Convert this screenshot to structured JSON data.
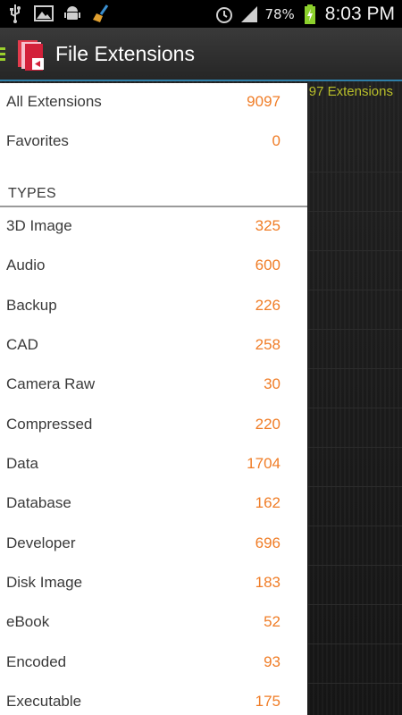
{
  "status_bar": {
    "battery_percent": "78%",
    "time": "8:03 PM",
    "icons": [
      "usb-icon",
      "image-icon",
      "android-debug-icon",
      "broom-icon",
      "alarm-icon",
      "signal-icon",
      "battery-charging-icon"
    ]
  },
  "action_bar": {
    "title": "File Extensions",
    "accent_color": "#9bd02c",
    "underline_color": "#2f7fa8"
  },
  "background": {
    "count_label": "97 Extensions",
    "count_color": "#b9bf2a"
  },
  "drawer": {
    "top_items": [
      {
        "label": "All Extensions",
        "count": "9097"
      },
      {
        "label": "Favorites",
        "count": "0"
      }
    ],
    "section_header": "TYPES",
    "types": [
      {
        "label": "3D Image",
        "count": "325"
      },
      {
        "label": "Audio",
        "count": "600"
      },
      {
        "label": "Backup",
        "count": "226"
      },
      {
        "label": "CAD",
        "count": "258"
      },
      {
        "label": "Camera Raw",
        "count": "30"
      },
      {
        "label": "Compressed",
        "count": "220"
      },
      {
        "label": "Data",
        "count": "1704"
      },
      {
        "label": "Database",
        "count": "162"
      },
      {
        "label": "Developer",
        "count": "696"
      },
      {
        "label": "Disk Image",
        "count": "183"
      },
      {
        "label": "eBook",
        "count": "52"
      },
      {
        "label": "Encoded",
        "count": "93"
      },
      {
        "label": "Executable",
        "count": "175"
      }
    ],
    "count_color": "#f07d27"
  }
}
